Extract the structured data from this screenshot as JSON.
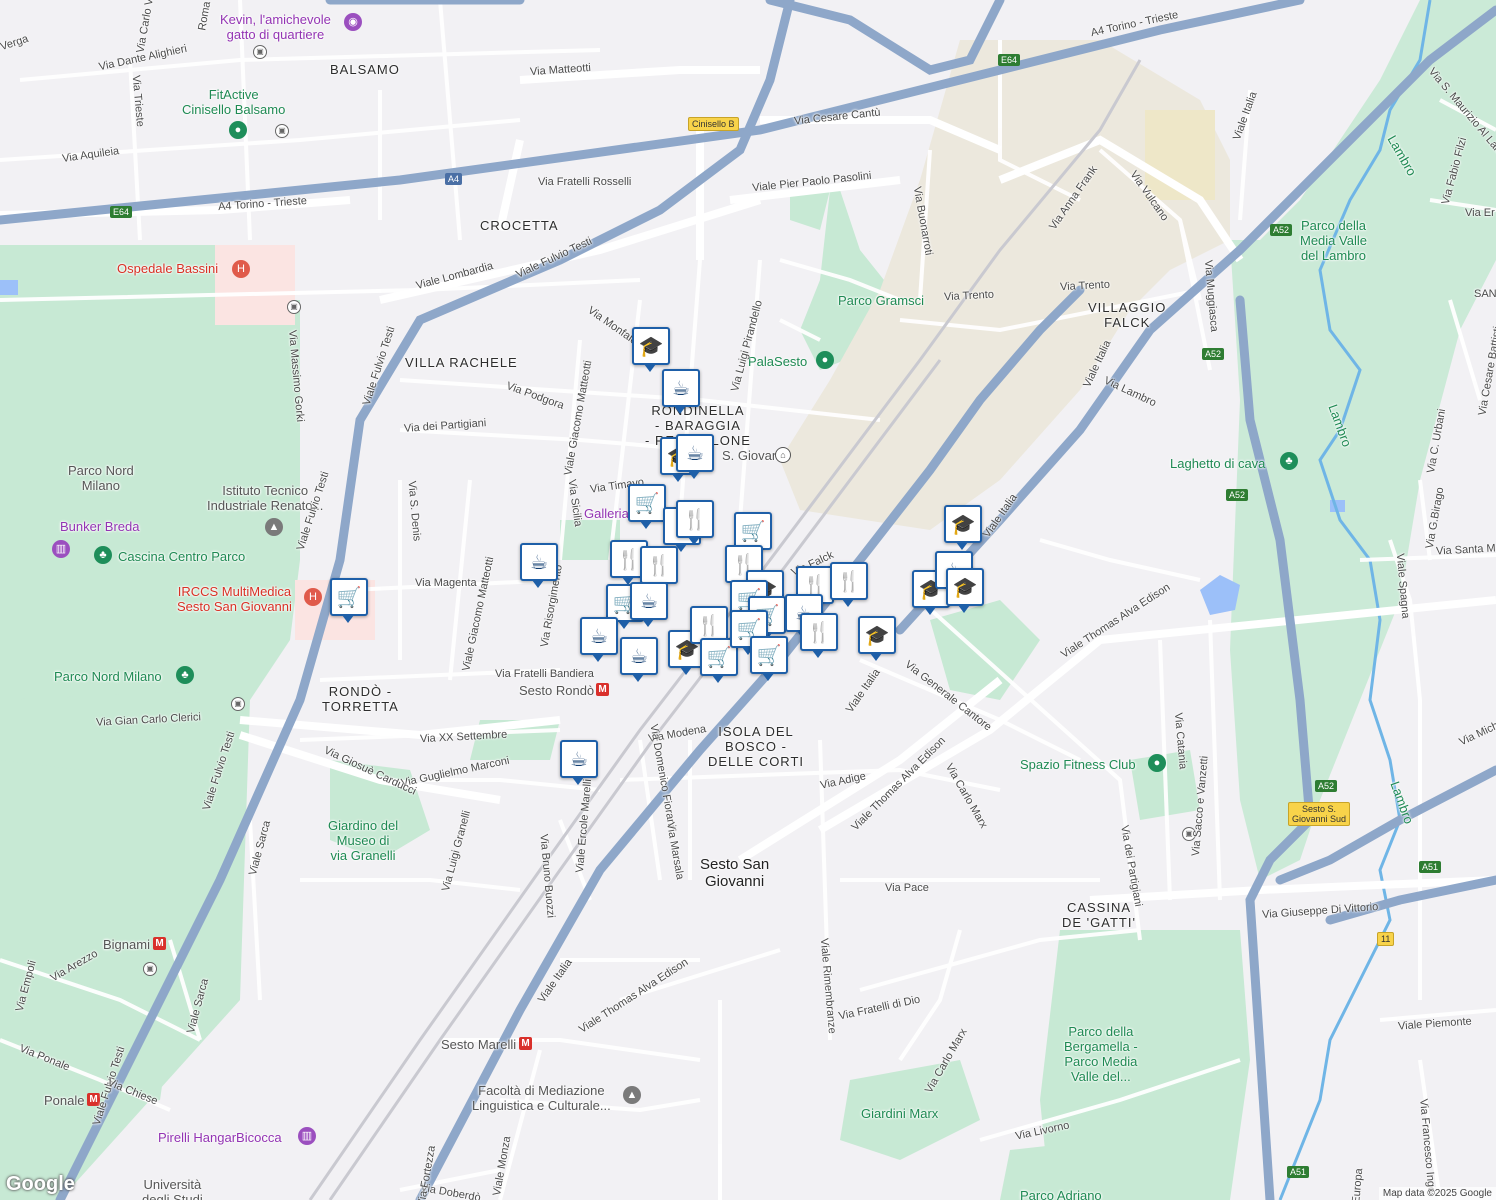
{
  "map": {
    "attribution": "Map data ©2025 Google",
    "logo": "Google",
    "colors": {
      "background": "#f2f1f4",
      "park": "#c7e9d4",
      "water": "#9cc0f9",
      "highway": "#8ea7c9",
      "major_road": "#ffffff",
      "industrial": "#ece8dd",
      "hospital": "#fbe4e2",
      "pin_border": "#1e5fa8",
      "pin_glyph": "#123f72"
    }
  },
  "areas": {
    "balsamo": "BALSAMO",
    "crocetta": "CROCETTA",
    "villa_rachele": "VILLA RACHELE",
    "rondinella_l1": "RONDINELLA",
    "rondinella_l2": "- BARAGGIA",
    "rondinella_l3": "- RESTELLONE",
    "villaggio_falck_l1": "VILLAGGIO",
    "villaggio_falck_l2": "FALCK",
    "rondo_torretta_l1": "RONDÒ -",
    "rondo_torretta_l2": "TORRETTA",
    "isola_l1": "ISOLA DEL",
    "isola_l2": "BOSCO -",
    "isola_l3": "DELLE CORTI",
    "cassina_l1": "CASSINA",
    "cassina_l2": "DE 'GATTI'",
    "sesto_l1": "Sesto San",
    "sesto_l2": "Giovanni"
  },
  "pois": {
    "kevin_l1": "Kevin, l'amichevole",
    "kevin_l2": "gatto di quartiere",
    "fitactive_l1": "FitActive",
    "fitactive_l2": "Cinisello Balsamo",
    "ospedale_bassini": "Ospedale Bassini",
    "parco_nord_milano_l1": "Parco Nord",
    "parco_nord_milano_l2": "Milano",
    "istituto_l1": "Istituto Tecnico",
    "istituto_l2": "Industriale Renato...",
    "bunker_breda": "Bunker Breda",
    "cascina_centro_parco": "Cascina Centro Parco",
    "irccs_l1": "IRCCS MultiMedica",
    "irccs_l2": "Sesto San Giovanni",
    "parco_nord_milano": "Parco Nord Milano",
    "parco_gramsci": "Parco Gramsci",
    "palasesto": "PalaSesto",
    "sesto_s_giovanni_station": "S. Giovanni",
    "galleria": "Galleria",
    "parco_lambro_l1": "Parco della",
    "parco_lambro_l2": "Media Valle",
    "parco_lambro_l3": "del Lambro",
    "laghetto": "Laghetto di cava",
    "spazio_fitness": "Spazio Fitness Club",
    "giardino_granelli_l1": "Giardino del",
    "giardino_granelli_l2": "Museo di",
    "giardino_granelli_l3": "via Granelli",
    "sesto_rondo": "Sesto Rondò",
    "bignami": "Bignami",
    "sesto_marelli": "Sesto Marelli",
    "ponale": "Ponale",
    "facolta_l1": "Facoltà di Mediazione",
    "facolta_l2": "Linguistica e Culturale...",
    "pirelli": "Pirelli HangarBicocca",
    "universita_l1": "Università",
    "universita_l2": "degli Studi",
    "bergamella_l1": "Parco della",
    "bergamella_l2": "Bergamella -",
    "bergamella_l3": "Parco Media",
    "bergamella_l4": "Valle del...",
    "giardini_marx": "Giardini Marx",
    "parco_adriano": "Parco Adriano",
    "lambro_1": "Lambro",
    "lambro_2": "Lambro",
    "lambro_3": "Lambro"
  },
  "streets": {
    "a4_1": "A4 Torino - Trieste",
    "a4_2": "A4 Torino - Trieste",
    "via_matteotti": "Via Matteotti",
    "via_cesare_cantu": "Via Cesare Cantù",
    "via_fratelli_rosselli": "Via Fratelli Rosselli",
    "viale_pier_paolo_pasolini": "Viale Pier Paolo Pasolini",
    "via_aquileia": "Via Aquileia",
    "via_dante_alighieri": "Via Dante Alighieri",
    "via_trieste": "Via Trieste",
    "viale_lombardia": "Viale Lombardia",
    "viale_fulvio_testi": "Viale Fulvio Testi",
    "viale_fulvio_testi_2": "Viale Fulvio Testi",
    "viale_fulvio_testi_3": "Viale Fulvio Testi",
    "viale_fulvio_testi_4": "Viale Fulvio Testi",
    "via_massimo_gorki": "Via Massimo Gorki",
    "via_podgora": "Via Podgora",
    "via_dei_partigiani": "Via dei Partigiani",
    "via_giacomo_matteotti": "Viale Giacomo Matteotti",
    "via_giacomo_matteotti_2": "Viale Giacomo Matteotti",
    "via_sicilia": "Via Sicilia",
    "via_timavo": "Via Timavo",
    "via_s_denis": "Via S. Denis",
    "via_magenta": "Via Magenta",
    "via_risorgimento": "Via Risorgimento",
    "via_fratelli_bandiera": "Via Fratelli Bandiera",
    "via_gian_carlo_clerici": "Via Gian Carlo Clerici",
    "via_xx_settembre": "Via XX Settembre",
    "via_guglielmo_marconi": "Via Guglielmo Marconi",
    "via_giosue_carducci": "Via Giosuè Carducci",
    "via_modena": "Via Modena",
    "via_domenico_fiorani": "Via Domenico Fiorani",
    "via_marsala": "Via Marsala",
    "via_ercole_marelli": "Viale Ercole Marelli",
    "via_bruno_buozzi": "Via Bruno Buozzi",
    "via_luigi_granelli": "Via Luigi Granelli",
    "viale_sarca": "Viale Sarca",
    "viale_sarca_2": "Viale Sarca",
    "via_arezzo": "Via Arezzo",
    "via_ponale": "Via Ponale",
    "via_chiese": "Via Chiese",
    "viale_monza": "Viale Monza",
    "via_luigi_pirandello": "Via Luigi Pirandello",
    "via_buonarroti": "Via Buonarroti",
    "via_anna_frank": "Via Anna Frank",
    "via_trento": "Via Trento",
    "via_trento_2": "Via Trento",
    "via_vulcano": "Via Vulcano",
    "viale_italia": "Viale Italia",
    "viale_italia_2": "Viale Italia",
    "viale_italia_3": "Viale Italia",
    "viale_italia_4": "Viale Italia",
    "viale_italia_5": "Viale Italia",
    "via_lambro": "Via Lambro",
    "via_muggiasca": "Via Muggiasca",
    "viale_thomas_alva_edison": "Viale Thomas Alva Edison",
    "viale_thomas_alva_edison_2": "Viale Thomas Alva Edison",
    "viale_thomas_alva_edison_3": "Viale Thomas Alva Edison",
    "via_generale_cantore": "Via Generale Cantore",
    "via_adige": "Via Adige",
    "via_carlo_marx": "Via Carlo Marx",
    "via_carlo_marx_2": "Via Carlo Marx",
    "viale_rimembranze": "Viale Rimembranze",
    "via_pace": "Via Pace",
    "via_dei_partigiani_2": "Via dei Partigiani",
    "via_catania": "Via Catania",
    "via_sacco_vanzetti": "Via Sacco e Vanzetti",
    "via_giuseppe_di_vittorio": "Via Giuseppe Di Vittorio",
    "via_fratelli_di_dio": "Via Fratelli di Dio",
    "via_livorno": "Via Livorno",
    "viale_spagna": "Viale Spagna",
    "via_santa_m": "Via Santa M",
    "via_c_urbani": "Via C. Urbani",
    "via_g_birago": "Via G.Birago",
    "via_cesare_battisti": "Via Cesare Battisti",
    "via_fabio_filzi": "Via Fabio Filzi",
    "via_s_maurizio": "Via S. Maurizio Al Lambro",
    "viale_piemonte": "Viale Piemonte",
    "via_francesco": "Via Francesco Ingo",
    "viale_europa": "Europa",
    "via_falck": "Via Falck",
    "via_monfalcone": "Via Monfalcone",
    "via_dobrd": "Via Doberdò",
    "via_fortezza": "Via Fortezza",
    "via_mich": "Via Mich",
    "via_empoli": "Via Empoli",
    "via_verga": "Verga",
    "via_carlo_villa": "Via Carlo Villa",
    "via_roma": "Roma",
    "via_er": "Via Er",
    "santa": "SANTA",
    "viale_s_alessandro": "Via Giuseppe"
  },
  "badges": {
    "e64_1": "E64",
    "e64_2": "E64",
    "a4": "A4",
    "cinisello": "Cinisello B",
    "a52_1": "A52",
    "a52_2": "A52",
    "a52_3": "A52",
    "a52_4": "A52",
    "sesto_sud_l1": "Sesto S.",
    "sesto_sud_l2": "Giovanni Sud",
    "a51_1": "A51",
    "a51_2": "A51",
    "r11": "11"
  },
  "markers": [
    {
      "type": "school",
      "glyph": "🎓"
    },
    {
      "type": "cafe",
      "glyph": "☕"
    },
    {
      "type": "school",
      "glyph": "🎓"
    },
    {
      "type": "cafe",
      "glyph": "☕"
    },
    {
      "type": "shopping",
      "glyph": "🛒"
    },
    {
      "type": "restaurant",
      "glyph": "🍴"
    },
    {
      "type": "restaurant",
      "glyph": "🍴"
    },
    {
      "type": "shopping",
      "glyph": "🛒"
    },
    {
      "type": "restaurant",
      "glyph": "🍴"
    },
    {
      "type": "cafe",
      "glyph": "☕"
    },
    {
      "type": "restaurant",
      "glyph": "🍴"
    },
    {
      "type": "restaurant",
      "glyph": "🍴"
    },
    {
      "type": "shopping",
      "glyph": "🛒"
    },
    {
      "type": "cafe",
      "glyph": "☕"
    },
    {
      "type": "cafe",
      "glyph": "☕"
    },
    {
      "type": "cafe",
      "glyph": "☕"
    },
    {
      "type": "school",
      "glyph": "🎓"
    },
    {
      "type": "restaurant",
      "glyph": "🍴"
    },
    {
      "type": "shopping",
      "glyph": "🛒"
    },
    {
      "type": "school",
      "glyph": "🎓"
    },
    {
      "type": "shopping",
      "glyph": "🛒"
    },
    {
      "type": "shopping",
      "glyph": "🛒"
    },
    {
      "type": "restaurant",
      "glyph": "🍴"
    },
    {
      "type": "restaurant",
      "glyph": "🍴"
    },
    {
      "type": "cafe",
      "glyph": "☕"
    },
    {
      "type": "shopping",
      "glyph": "🛒"
    },
    {
      "type": "shopping",
      "glyph": "🛒"
    },
    {
      "type": "restaurant",
      "glyph": "🍴"
    },
    {
      "type": "school",
      "glyph": "🎓"
    },
    {
      "type": "school",
      "glyph": "🎓"
    },
    {
      "type": "cafe",
      "glyph": "☕"
    },
    {
      "type": "school",
      "glyph": "🎓"
    },
    {
      "type": "school",
      "glyph": "🎓"
    },
    {
      "type": "cafe",
      "glyph": "☕"
    },
    {
      "type": "shopping",
      "glyph": "🛒"
    }
  ]
}
